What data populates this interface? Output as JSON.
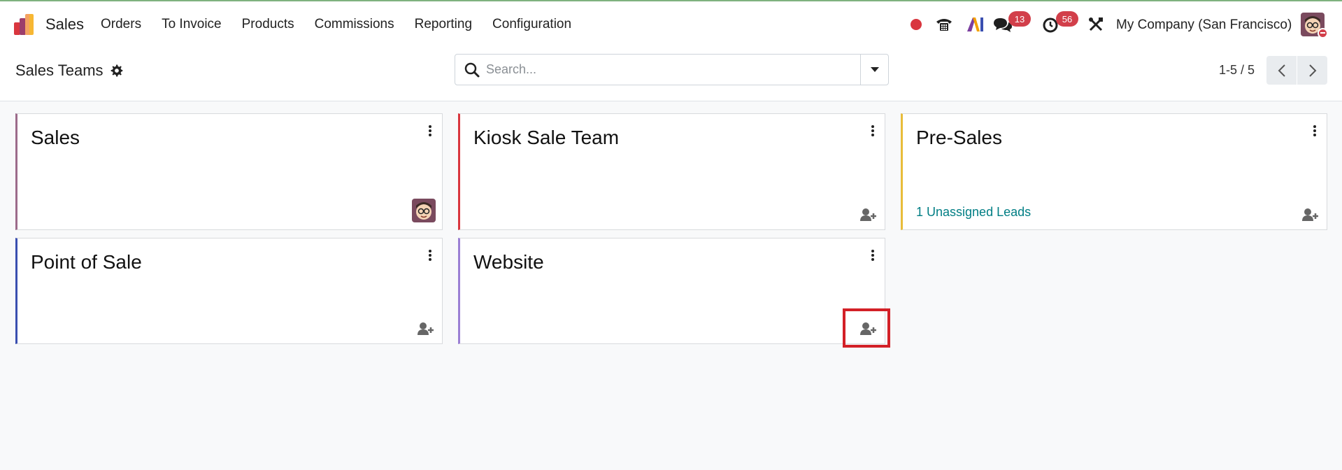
{
  "app": {
    "name": "Sales"
  },
  "menu": [
    "Orders",
    "To Invoice",
    "Products",
    "Commissions",
    "Reporting",
    "Configuration"
  ],
  "systray": {
    "chat_count": "13",
    "activity_count": "56",
    "company": "My Company (San Francisco)"
  },
  "control": {
    "breadcrumb": "Sales Teams",
    "search_placeholder": "Search...",
    "pager": "1-5 / 5"
  },
  "teams": [
    {
      "name": "Sales",
      "accent": "#9c6b8a",
      "link": "",
      "footer": "avatar"
    },
    {
      "name": "Kiosk Sale Team",
      "accent": "#d9363e",
      "link": "",
      "footer": "user-plus-icon"
    },
    {
      "name": "Pre-Sales",
      "accent": "#e8bc3a",
      "link": "1 Unassigned Leads",
      "footer": "user-plus-icon"
    },
    {
      "name": "Point of Sale",
      "accent": "#3a4fb0",
      "link": "",
      "footer": "user-plus-icon"
    },
    {
      "name": "Website",
      "accent": "#9b7fd4",
      "link": "",
      "footer": "user-plus-icon"
    }
  ],
  "colors": {
    "accent_teal": "#017e84",
    "badge_red": "#d23f4a",
    "highlight_red": "#d32027"
  }
}
